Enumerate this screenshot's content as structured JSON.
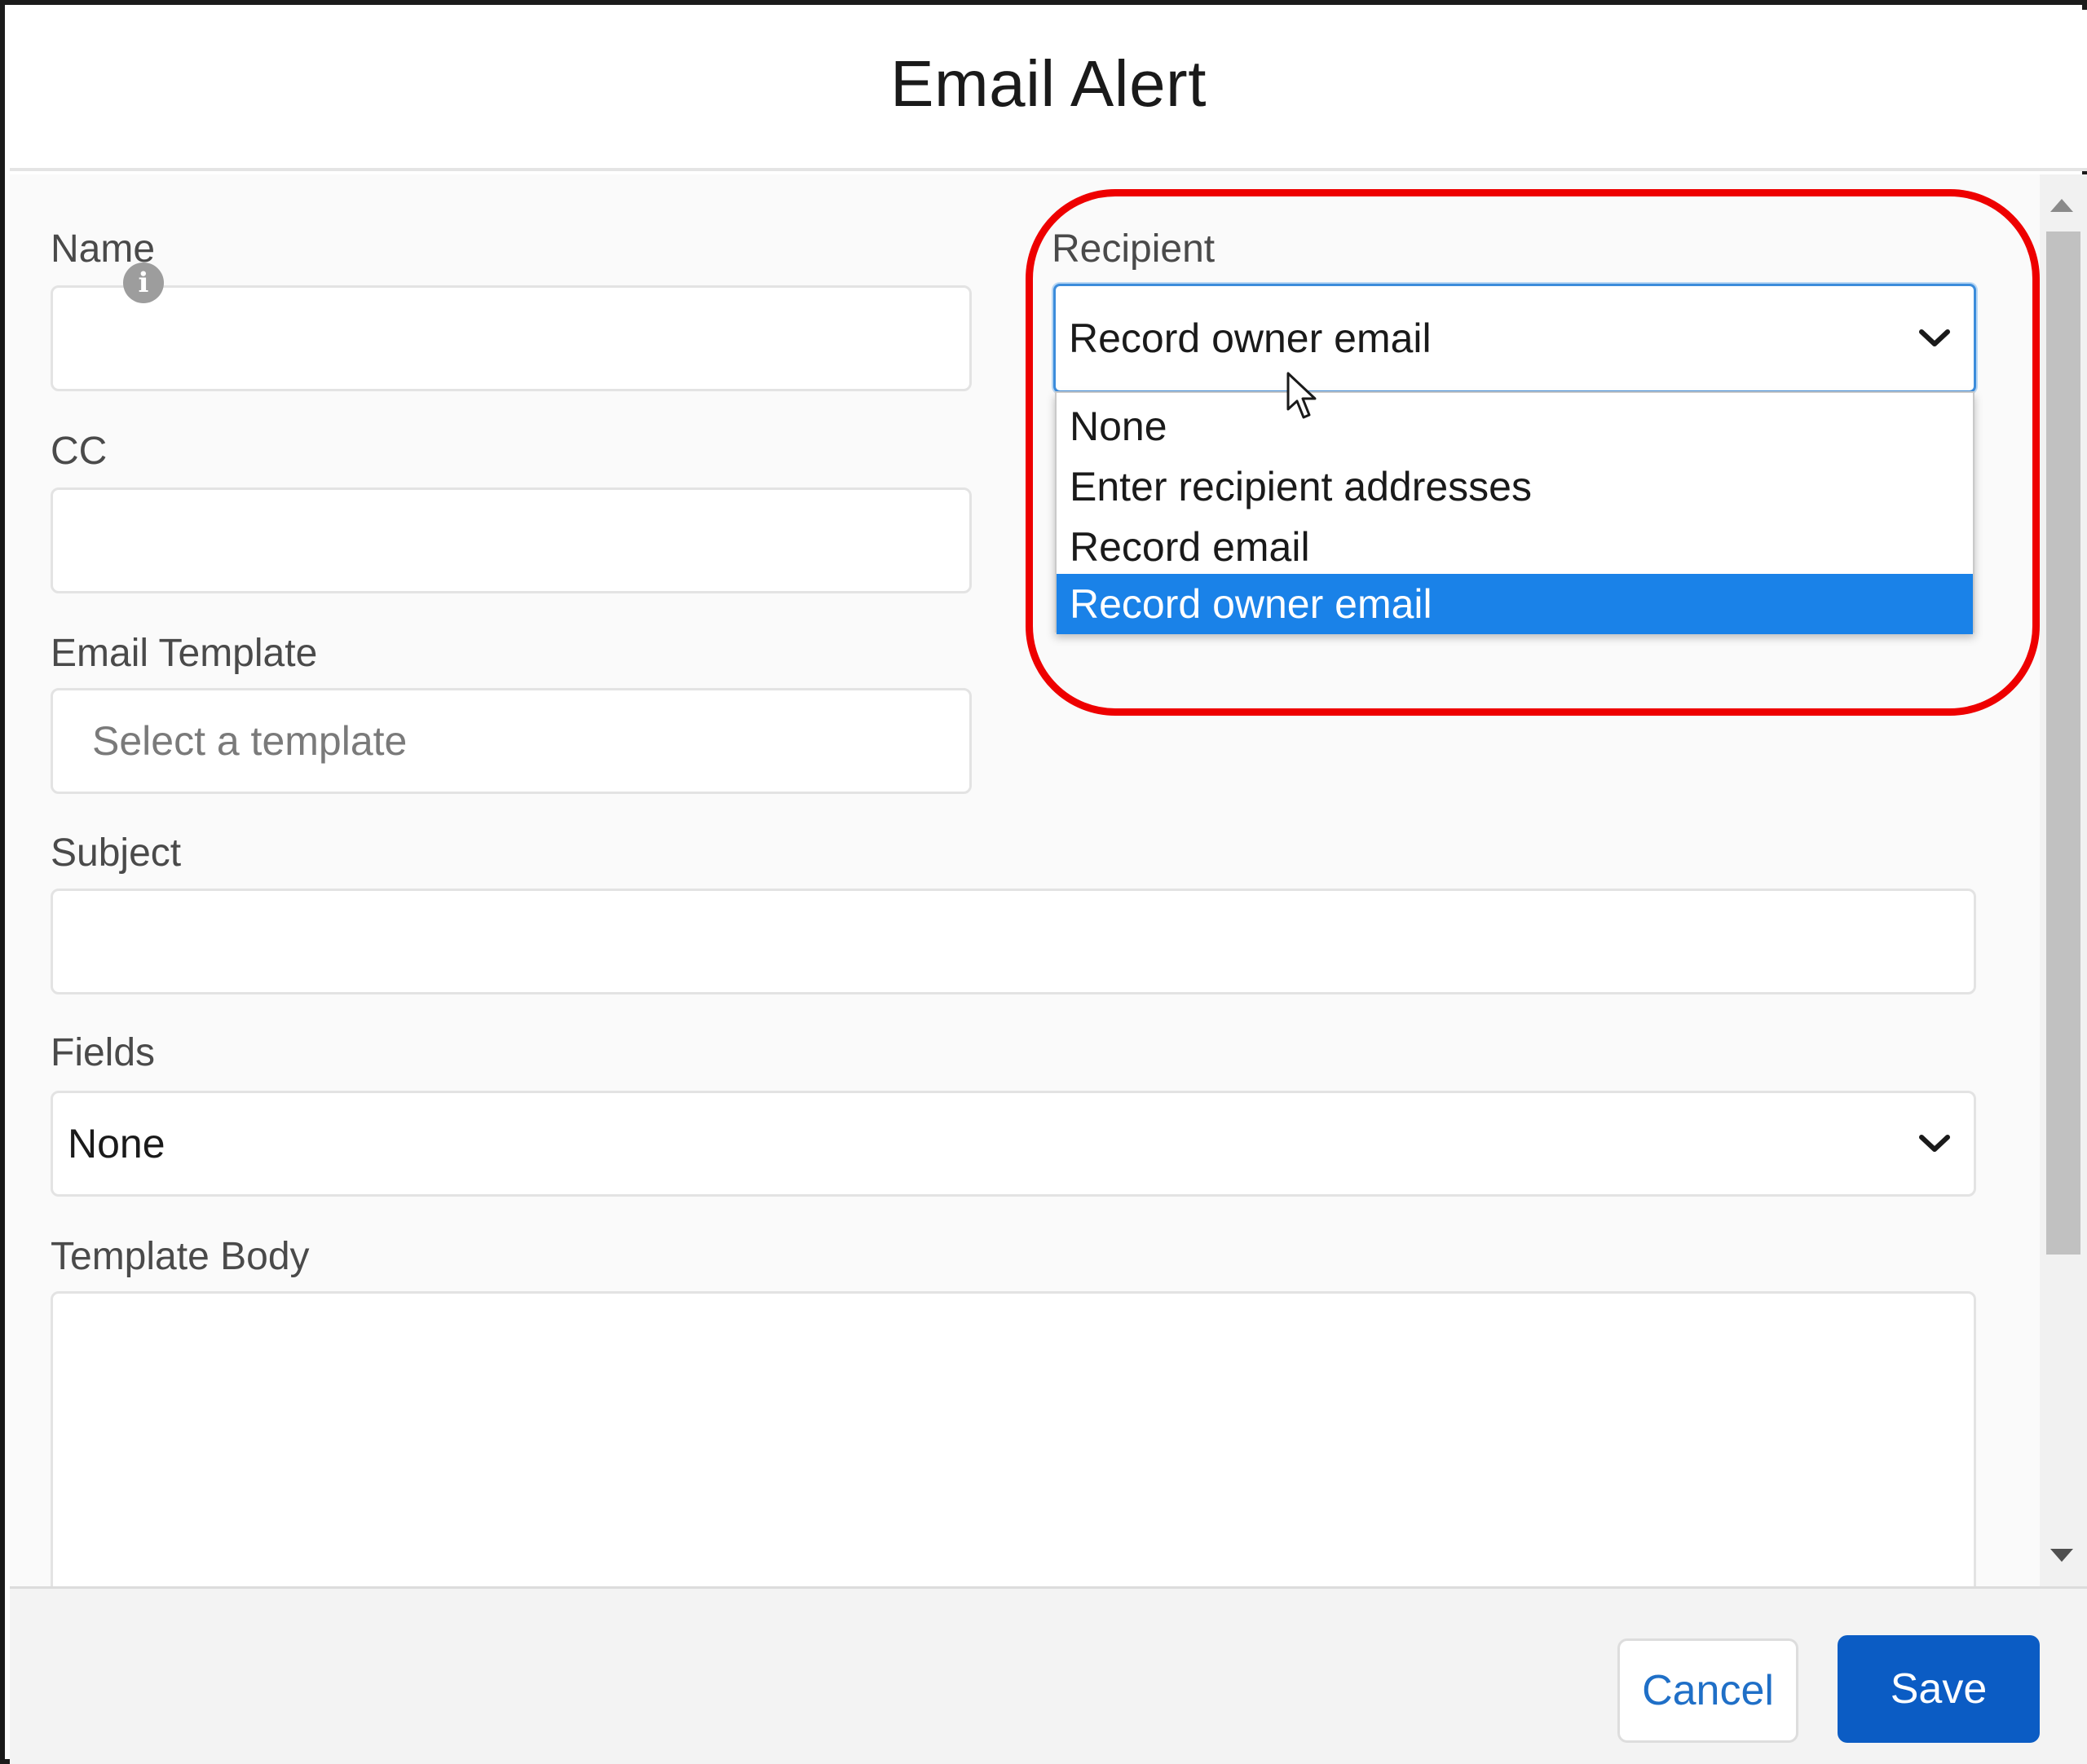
{
  "dialog": {
    "title": "Email Alert"
  },
  "form": {
    "name": {
      "label": "Name",
      "value": ""
    },
    "cc": {
      "label": "CC",
      "value": "",
      "info_icon": "info-icon"
    },
    "email_template": {
      "label": "Email Template",
      "placeholder": "Select a template"
    },
    "subject": {
      "label": "Subject",
      "value": ""
    },
    "fields": {
      "label": "Fields",
      "selected": "None"
    },
    "template_body": {
      "label": "Template Body",
      "value": ""
    },
    "recipient": {
      "label": "Recipient",
      "selected": "Record owner email",
      "options": [
        "None",
        "Enter recipient addresses",
        "Record email",
        "Record owner email"
      ],
      "highlighted_option": "Record owner email"
    }
  },
  "footer": {
    "cancel_label": "Cancel",
    "save_label": "Save"
  },
  "colors": {
    "annotation": "#ee0000",
    "selected_option": "#1a82e8",
    "primary_button": "#0b5cc4",
    "focus_border": "#3c8cdb"
  }
}
